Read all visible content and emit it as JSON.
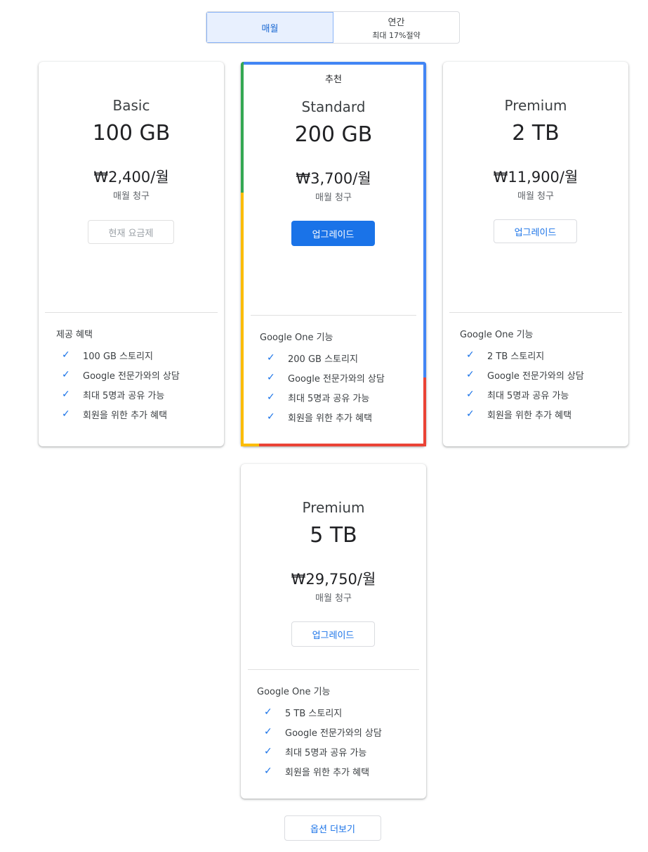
{
  "billing_toggle": {
    "monthly_label": "매월",
    "yearly_label": "연간",
    "yearly_sub": "최대 17%절약"
  },
  "plans": [
    {
      "name": "Basic",
      "size": "100 GB",
      "price": "₩2,400/월",
      "billing": "매월 청구",
      "button_label": "현재 요금제",
      "features_title": "제공 혜택",
      "features": [
        "100 GB 스토리지",
        "Google 전문가와의 상담",
        "최대 5명과 공유 가능",
        "회원을 위한 추가 혜택"
      ]
    },
    {
      "badge": "추천",
      "name": "Standard",
      "size": "200 GB",
      "price": "₩3,700/월",
      "billing": "매월 청구",
      "button_label": "업그레이드",
      "features_title": "Google One 기능",
      "features": [
        "200 GB 스토리지",
        "Google 전문가와의 상담",
        "최대 5명과 공유 가능",
        "회원을 위한 추가 혜택"
      ]
    },
    {
      "name": "Premium",
      "size": "2 TB",
      "price": "₩11,900/월",
      "billing": "매월 청구",
      "button_label": "업그레이드",
      "features_title": "Google One 기능",
      "features": [
        "2 TB 스토리지",
        "Google 전문가와의 상담",
        "최대 5명과 공유 가능",
        "회원을 위한 추가 혜택"
      ]
    },
    {
      "name": "Premium",
      "size": "5 TB",
      "price": "₩29,750/월",
      "billing": "매월 청구",
      "button_label": "업그레이드",
      "features_title": "Google One 기능",
      "features": [
        "5 TB 스토리지",
        "Google 전문가와의 상담",
        "최대 5명과 공유 가능",
        "회원을 위한 추가 혜택"
      ]
    }
  ],
  "more_options_label": "옵션 더보기",
  "colors": {
    "accent": "#1a73e8",
    "google_blue": "#4285f4",
    "google_red": "#ea4335",
    "google_yellow": "#fbbc04",
    "google_green": "#34a853"
  },
  "icons": {
    "feature_check": "check-icon"
  }
}
